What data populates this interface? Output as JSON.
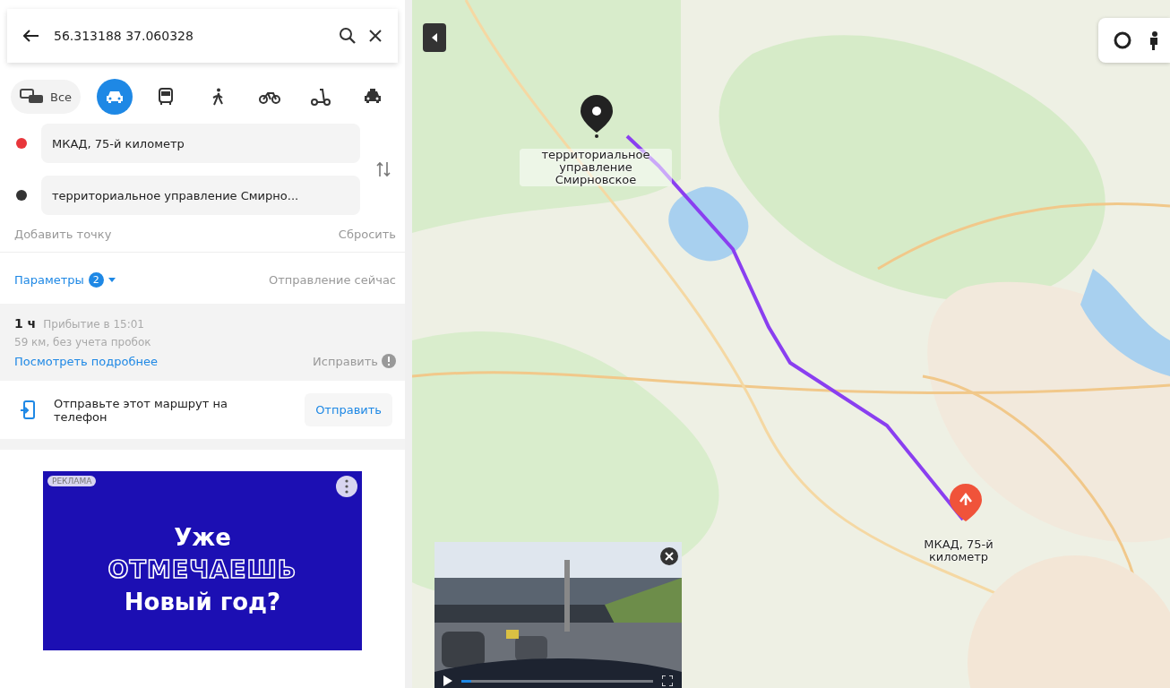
{
  "search": {
    "value": "56.313188 37.060328"
  },
  "modes": [
    {
      "kind": "all",
      "label": "Все",
      "selected": false
    },
    {
      "kind": "car",
      "selected": true
    },
    {
      "kind": "bus",
      "selected": false
    },
    {
      "kind": "walk",
      "selected": false
    },
    {
      "kind": "bike",
      "selected": false
    },
    {
      "kind": "scooter",
      "selected": false
    },
    {
      "kind": "taxi",
      "selected": false
    }
  ],
  "points": [
    {
      "value": "МКАД, 75-й километр",
      "color": "#e8363b"
    },
    {
      "value": "территориальное управление Смирно...",
      "color": "#333333"
    }
  ],
  "add_point": "Добавить точку",
  "reset": "Сбросить",
  "params": {
    "label": "Параметры",
    "count": "2",
    "departure": "Отправление сейчас"
  },
  "route": {
    "duration": "1 ч",
    "arrival": "Прибытие в 15:01",
    "distance": "59 км, без учета пробок",
    "details_link": "Посмотреть подробнее",
    "fix": "Исправить"
  },
  "send": {
    "text": "Отправьте этот маршрут на телефон",
    "button": "Отправить"
  },
  "ad": {
    "badge": "РЕКЛАМА",
    "lines": [
      "Уже",
      "ОТМЕЧАЕШЬ",
      "Новый год?"
    ]
  },
  "map": {
    "start_label": "территориальное управление Смирновское",
    "end_label": "МКАД, 75-й километр"
  },
  "video": {
    "level": 0.05
  }
}
